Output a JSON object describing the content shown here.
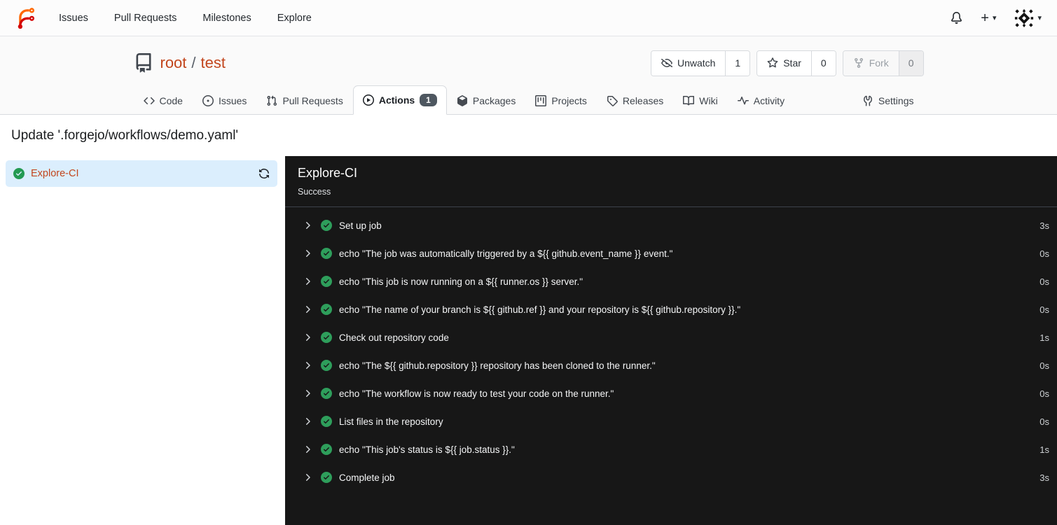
{
  "navbar": {
    "links": [
      {
        "label": "Issues"
      },
      {
        "label": "Pull Requests"
      },
      {
        "label": "Milestones"
      },
      {
        "label": "Explore"
      }
    ],
    "plus_label": "+"
  },
  "repo_header": {
    "owner": "root",
    "separator": "/",
    "name": "test",
    "buttons": [
      {
        "label": "Unwatch",
        "count": "1"
      },
      {
        "label": "Star",
        "count": "0"
      },
      {
        "label": "Fork",
        "count": "0"
      }
    ]
  },
  "tabs": [
    {
      "label": "Code"
    },
    {
      "label": "Issues"
    },
    {
      "label": "Pull Requests"
    },
    {
      "label": "Actions",
      "badge": "1"
    },
    {
      "label": "Packages"
    },
    {
      "label": "Projects"
    },
    {
      "label": "Releases"
    },
    {
      "label": "Wiki"
    },
    {
      "label": "Activity"
    },
    {
      "label": "Settings"
    }
  ],
  "page": {
    "title": "Update '.forgejo/workflows/demo.yaml'"
  },
  "sidebar": {
    "job_name": "Explore-CI"
  },
  "panel": {
    "title": "Explore-CI",
    "status": "Success",
    "steps": [
      {
        "name": "Set up job",
        "duration": "3s"
      },
      {
        "name": "echo \"The job was automatically triggered by a ${{ github.event_name }} event.\"",
        "duration": "0s"
      },
      {
        "name": "echo \"This job is now running on a ${{ runner.os }} server.\"",
        "duration": "0s"
      },
      {
        "name": "echo \"The name of your branch is ${{ github.ref }} and your repository is ${{ github.repository }}.\"",
        "duration": "0s"
      },
      {
        "name": "Check out repository code",
        "duration": "1s"
      },
      {
        "name": "echo \"The ${{ github.repository }} repository has been cloned to the runner.\"",
        "duration": "0s"
      },
      {
        "name": "echo \"The workflow is now ready to test your code on the runner.\"",
        "duration": "0s"
      },
      {
        "name": "List files in the repository",
        "duration": "0s"
      },
      {
        "name": "echo \"This job's status is ${{ job.status }}.\"",
        "duration": "1s"
      },
      {
        "name": "Complete job",
        "duration": "3s"
      }
    ]
  },
  "colors": {
    "primary_link": "#c2461d",
    "success_green": "#2e9e5b",
    "panel_background": "#171717",
    "selected_job_background": "#dbeefd",
    "active_tab_badge": "#4e5760"
  }
}
